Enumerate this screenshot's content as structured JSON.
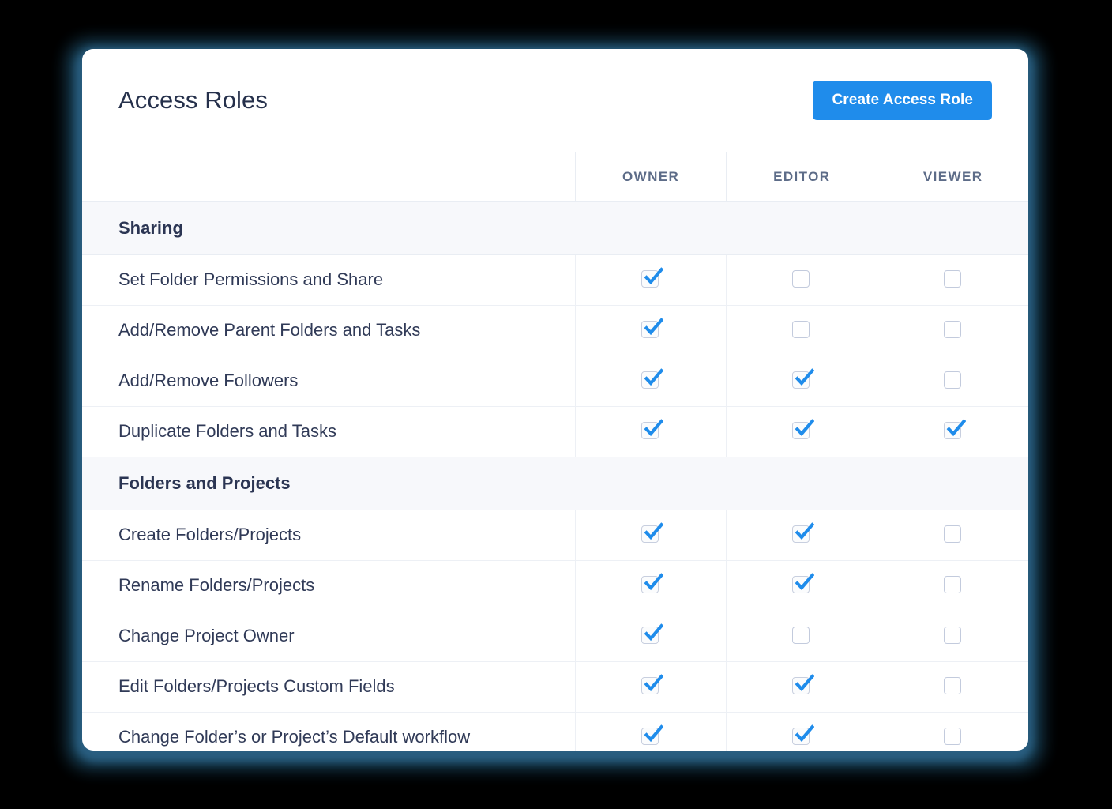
{
  "header": {
    "title": "Access Roles",
    "create_button_label": "Create Access Role"
  },
  "colors": {
    "accent": "#1f8ceb",
    "check": "#1f8ceb",
    "title_text": "#25304b",
    "section_bg": "#f7f8fb",
    "header_text": "#5d6c88",
    "row_border": "#edf0f5",
    "page_background": "#000000",
    "glow": "#2c6286"
  },
  "table": {
    "columns": [
      {
        "key": "label",
        "label": ""
      },
      {
        "key": "owner",
        "label": "OWNER"
      },
      {
        "key": "editor",
        "label": "EDITOR"
      },
      {
        "key": "viewer",
        "label": "VIEWER"
      }
    ],
    "sections": [
      {
        "title": "Sharing",
        "rows": [
          {
            "label": "Set Folder Permissions and Share",
            "owner": true,
            "editor": false,
            "viewer": false
          },
          {
            "label": "Add/Remove Parent Folders and Tasks",
            "owner": true,
            "editor": false,
            "viewer": false
          },
          {
            "label": "Add/Remove Followers",
            "owner": true,
            "editor": true,
            "viewer": false
          },
          {
            "label": "Duplicate Folders and Tasks",
            "owner": true,
            "editor": true,
            "viewer": true
          }
        ]
      },
      {
        "title": "Folders and Projects",
        "rows": [
          {
            "label": "Create Folders/Projects",
            "owner": true,
            "editor": true,
            "viewer": false
          },
          {
            "label": "Rename Folders/Projects",
            "owner": true,
            "editor": true,
            "viewer": false
          },
          {
            "label": "Change Project Owner",
            "owner": true,
            "editor": false,
            "viewer": false
          },
          {
            "label": "Edit Folders/Projects Custom Fields",
            "owner": true,
            "editor": true,
            "viewer": false
          },
          {
            "label": "Change Folder’s or Project’s Default workflow",
            "owner": true,
            "editor": true,
            "viewer": false
          }
        ]
      }
    ]
  },
  "icons": {
    "checkbox_checked": "checkbox-checked-icon",
    "checkbox_unchecked": "checkbox-unchecked-icon"
  }
}
